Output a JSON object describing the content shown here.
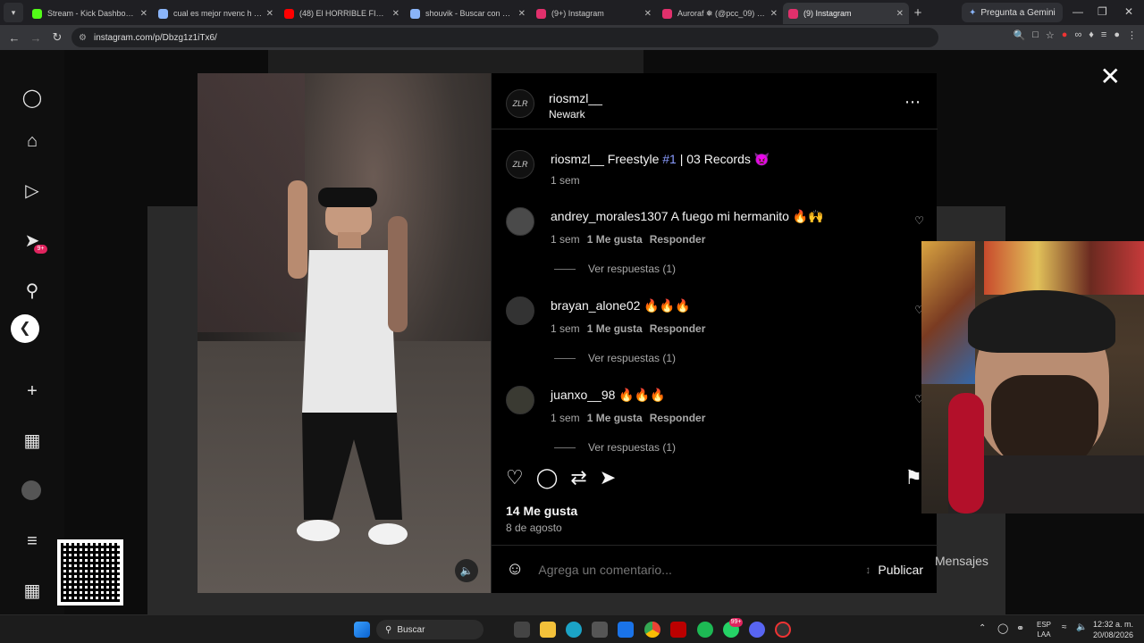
{
  "browser": {
    "tabs": [
      {
        "title": "Stream - Kick Dashboard -",
        "color": "#53fc18"
      },
      {
        "title": "cual es mejor nvenc h 264",
        "color": "#8ab4f8"
      },
      {
        "title": "(48) El HORRIBLE FINAL de",
        "color": "#ff0000"
      },
      {
        "title": "shouvik - Buscar con Goo",
        "color": "#8ab4f8"
      },
      {
        "title": "(9+) Instagram",
        "color": "#e1306c"
      },
      {
        "title": "Auroraf ❅ (@pcc_09) • In",
        "color": "#e1306c"
      },
      {
        "title": "(9) Instagram",
        "color": "#e1306c"
      }
    ],
    "gemini_label": "Pregunta a Gemini",
    "url": "instagram.com/p/Dbzg1z1iTx6/"
  },
  "post": {
    "author": "riosmzl__",
    "location": "Newark",
    "avatar_text": "ZLR",
    "caption_user": "riosmzl__",
    "caption_pre": "Freestyle ",
    "caption_tag": "#1",
    "caption_post": " | 03 Records 👿",
    "caption_time": "1 sem",
    "comments": [
      {
        "user": "andrey_morales1307",
        "text": "A fuego mi hermanito 🔥🙌",
        "time": "1 sem",
        "likes": "1 Me gusta",
        "reply": "Responder",
        "replies": "Ver respuestas (1)"
      },
      {
        "user": "brayan_alone02",
        "text": "🔥🔥🔥",
        "time": "1 sem",
        "likes": "1 Me gusta",
        "reply": "Responder",
        "replies": "Ver respuestas (1)"
      },
      {
        "user": "juanxo__98",
        "text": "🔥🔥🔥",
        "time": "1 sem",
        "likes": "1 Me gusta",
        "reply": "Responder",
        "replies": "Ver respuestas (1)"
      }
    ],
    "likes": "14 Me gusta",
    "date": "8 de agosto",
    "comment_placeholder": "Agrega un comentario...",
    "publish": "Publicar"
  },
  "sidebar": {
    "notif_badge": "9+"
  },
  "background": {
    "mensajes": "Mensajes"
  },
  "taskbar": {
    "search": "Buscar",
    "lang1": "ESP",
    "lang2": "LAA",
    "time": "12:32 a. m.",
    "date": "20/08/2026",
    "whatsapp_badge": "99+"
  }
}
